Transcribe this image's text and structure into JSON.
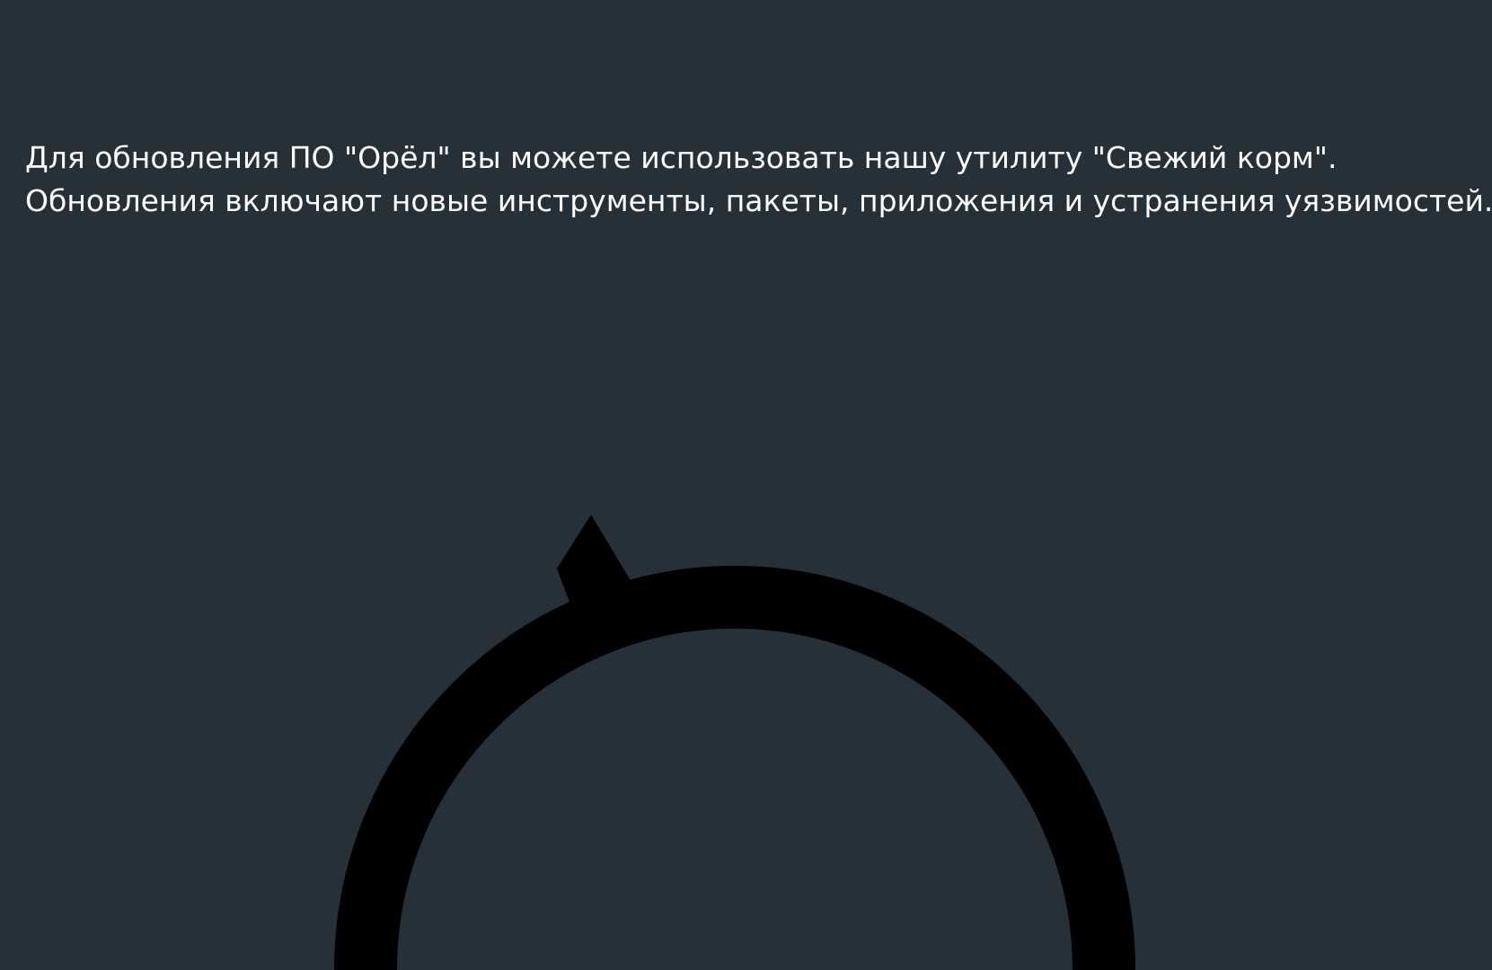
{
  "message": {
    "line1": "Для обновления ПО \"Орёл\" вы можете использовать нашу утилиту \"Свежий корм\".",
    "line2": "Обновления включают новые инструменты, пакеты, приложения и устранения уязвимостей."
  },
  "graphic": {
    "icon": "refresh-icon",
    "color": "#000000"
  },
  "colors": {
    "background": "#263038",
    "text": "#ffffff"
  }
}
